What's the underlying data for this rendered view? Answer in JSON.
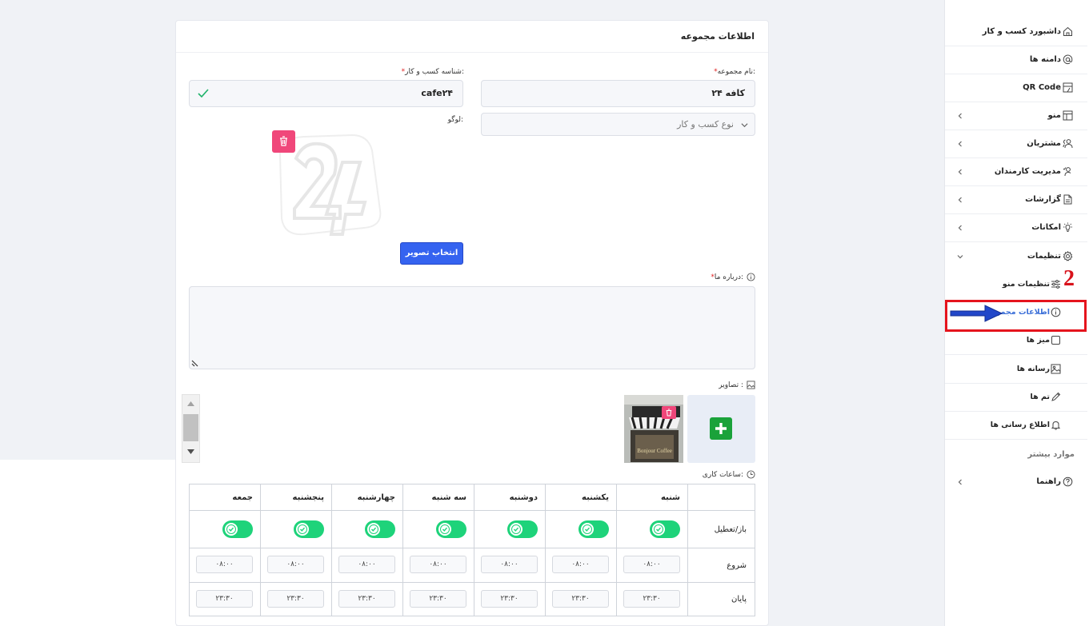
{
  "card": {
    "title": "اطلاعات مجموعه",
    "name_label": "نام مجموعه:",
    "name_value": "کافه ۲۴",
    "business_type_placeholder": "نوع کسب و کار",
    "business_id_label": "شناسه کسب و کار:",
    "business_id_value": "cafe۲۴",
    "logo_label": "لوگو:",
    "select_image_button": "انتخاب تصویر",
    "about_label": "درباره ما:",
    "images_label": "تصاویر :",
    "working_hours_label": "ساعات کاری:",
    "required_mark": "*"
  },
  "hours": {
    "days": [
      "شنبه",
      "یکشنبه",
      "دوشنبه",
      "سه شنبه",
      "چهارشنبه",
      "پنجشنبه",
      "جمعه"
    ],
    "row_open": "باز/تعطیل",
    "row_start": "شروع",
    "row_end": "پایان",
    "open": [
      true,
      true,
      true,
      true,
      true,
      true,
      true
    ],
    "start": [
      "۰۸:۰۰",
      "۰۸:۰۰",
      "۰۸:۰۰",
      "۰۸:۰۰",
      "۰۸:۰۰",
      "۰۸:۰۰",
      "۰۸:۰۰"
    ],
    "end": [
      "۲۳:۳۰",
      "۲۳:۳۰",
      "۲۳:۳۰",
      "۲۳:۳۰",
      "۲۳:۳۰",
      "۲۳:۳۰",
      "۲۳:۳۰"
    ],
    "toggle_color": "#1ed37a"
  },
  "sidebar": {
    "items": [
      {
        "label": "داشبورد کسب و کار",
        "icon": "home-icon"
      },
      {
        "label": "دامنه ها",
        "icon": "at-icon"
      },
      {
        "label": "QR Code",
        "icon": "qr-code-icon"
      },
      {
        "label": "منو",
        "icon": "menu-layout-icon"
      },
      {
        "label": "مشتریان",
        "icon": "users-icon"
      },
      {
        "label": "مدیریت کارمندان",
        "icon": "user-check-icon"
      },
      {
        "label": "گزارشات",
        "icon": "report-icon"
      },
      {
        "label": "امکانات",
        "icon": "bulb-icon"
      },
      {
        "label": "تنظیمات",
        "icon": "gear-icon"
      }
    ],
    "sub_items": [
      {
        "label": "تنظیمات منو",
        "icon": "sliders-icon"
      },
      {
        "label": "اطلاعات مجموعه",
        "icon": "info-icon"
      },
      {
        "label": "میز ها",
        "icon": "square-icon"
      },
      {
        "label": "رسانه ها",
        "icon": "image-icon"
      },
      {
        "label": "تم ها",
        "icon": "pen-icon"
      },
      {
        "label": "اطلاع رسانی ها",
        "icon": "bell-icon"
      }
    ],
    "more_label": "موارد بیشتر",
    "help_label": "راهنما",
    "active_color": "#3b6fd8"
  },
  "annotation": {
    "number": "2",
    "color": "#e5141d"
  }
}
